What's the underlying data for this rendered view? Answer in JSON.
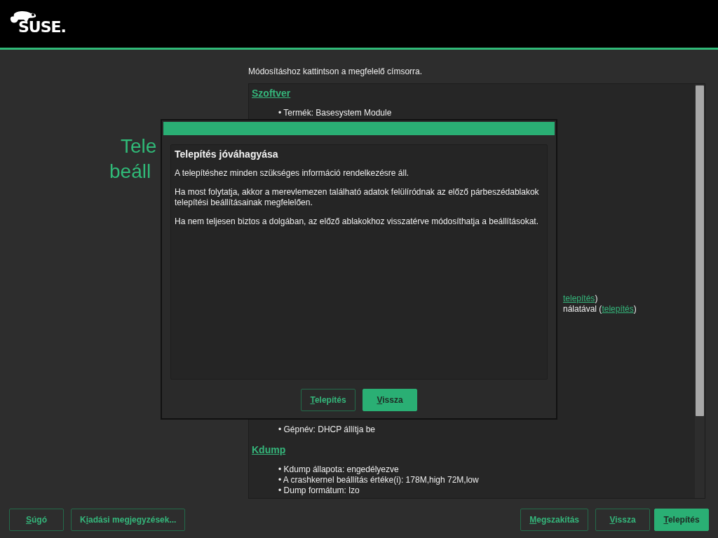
{
  "logo": {
    "text": "SUSE."
  },
  "page_title": {
    "lines": [
      "Tele",
      "beáll"
    ]
  },
  "instruction": "Módosításhoz kattintson a megfelelő címsorra.",
  "summary": {
    "groups": [
      {
        "lines": [
          {
            "kind": "heading",
            "text": "Szoftver"
          },
          {
            "kind": "item",
            "segments": [
              {
                "text": "• Termék: Basesystem Module"
              }
            ]
          }
        ]
      },
      {
        "lines": [
          {
            "kind": "fragment",
            "segments": [
              {
                "text": "telepítés",
                "link": true
              },
              {
                "text": ")"
              }
            ]
          },
          {
            "kind": "fragment",
            "segments": [
              {
                "text": "nálatával ("
              },
              {
                "text": "telepítés",
                "link": true
              },
              {
                "text": ")"
              }
            ]
          }
        ]
      },
      {
        "lines": [
          {
            "kind": "item",
            "segments": [
              {
                "text": "• Gépnév: DHCP állítja be"
              }
            ]
          },
          {
            "kind": "heading",
            "text": "Kdump"
          },
          {
            "kind": "item",
            "segments": [
              {
                "text": "• Kdump állapota: engedélyezve"
              }
            ]
          },
          {
            "kind": "item",
            "segments": [
              {
                "text": "• A crashkernel beállítás értéke(i): 178M,high 72M,low"
              }
            ]
          },
          {
            "kind": "item",
            "segments": [
              {
                "text": "• Dump formátum: lzo"
              }
            ]
          }
        ]
      }
    ]
  },
  "dialog": {
    "heading": "Telepítés jóváhagyása",
    "paragraphs": [
      "A telepítéshez minden szükséges információ rendelkezésre áll.",
      "Ha most folytatja, akkor a merevlemezen található adatok felülíródnak az előző párbeszédablakok telepítési beállításainak megfelelően.",
      "Ha nem teljesen biztos a dolgában, az előző ablakokhoz visszatérve módosíthatja a beállításokat."
    ],
    "buttons": [
      {
        "access_key": "T",
        "label_after": "elepítés",
        "primary": false
      },
      {
        "access_key": "V",
        "label_after": "issza",
        "primary": true
      }
    ]
  },
  "footer": {
    "left": [
      {
        "access_key": "S",
        "label_after": "úgó",
        "primary": false
      },
      {
        "label_before": "K",
        "access_key": "i",
        "label_after": "adási megjegyzések...",
        "primary": false
      }
    ],
    "right": [
      {
        "access_key": "M",
        "label_after": "egszakítás",
        "primary": false
      },
      {
        "access_key": "V",
        "label_after": "issza",
        "primary": false
      },
      {
        "access_key": "T",
        "label_after": "elepítés",
        "primary": true
      }
    ]
  }
}
